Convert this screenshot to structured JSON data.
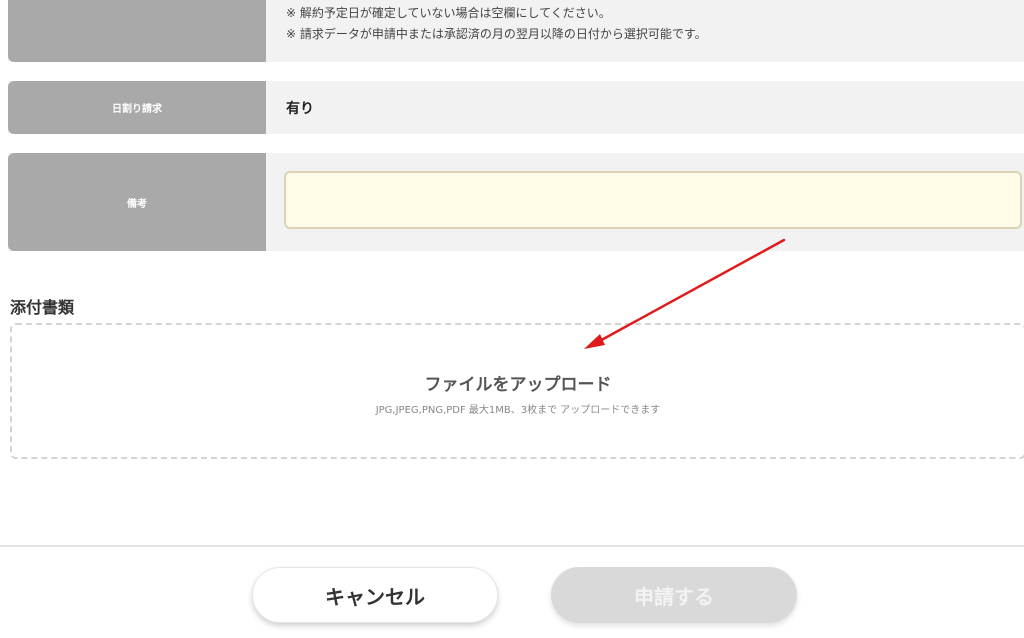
{
  "contract_end_notes": {
    "note_1": "※ 解約予定日が確定していない場合は空欄にしてください。",
    "note_2": "※ 請求データが申請中または承認済の月の翌月以降の日付から選択可能です。"
  },
  "prorated_billing": {
    "label": "日割り請求",
    "value": "有り"
  },
  "remarks": {
    "label": "備考",
    "value": ""
  },
  "attachments": {
    "title": "添付書類",
    "upload_label": "ファイルをアップロード",
    "upload_hint": "JPG,JPEG,PNG,PDF 最大1MB、3枚まで アップロードできます"
  },
  "footer": {
    "cancel_label": "キャンセル",
    "submit_label": "申請する"
  },
  "colors": {
    "annotation_arrow": "#e01b1b",
    "label_bg": "#a9a9a9",
    "input_bg": "#fffbe6"
  }
}
